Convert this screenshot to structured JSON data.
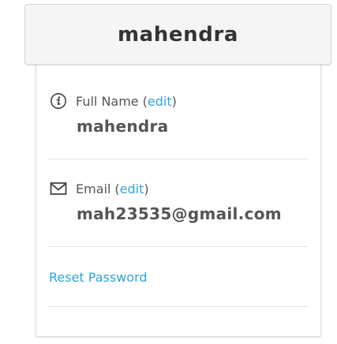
{
  "header": {
    "title": "mahendra"
  },
  "full_name": {
    "label": "Full Name",
    "open_paren": "(",
    "edit_label": "edit",
    "close_paren": ")",
    "value": "mahendra",
    "icon": "info-circle-icon"
  },
  "email": {
    "label": "Email",
    "open_paren": "(",
    "edit_label": "edit",
    "close_paren": ")",
    "value": "mah23535@gmail.com",
    "icon": "envelope-icon"
  },
  "reset_password": {
    "label": "Reset Password"
  },
  "colors": {
    "link": "#2fa4d6",
    "text": "#555555",
    "title": "#333333"
  }
}
